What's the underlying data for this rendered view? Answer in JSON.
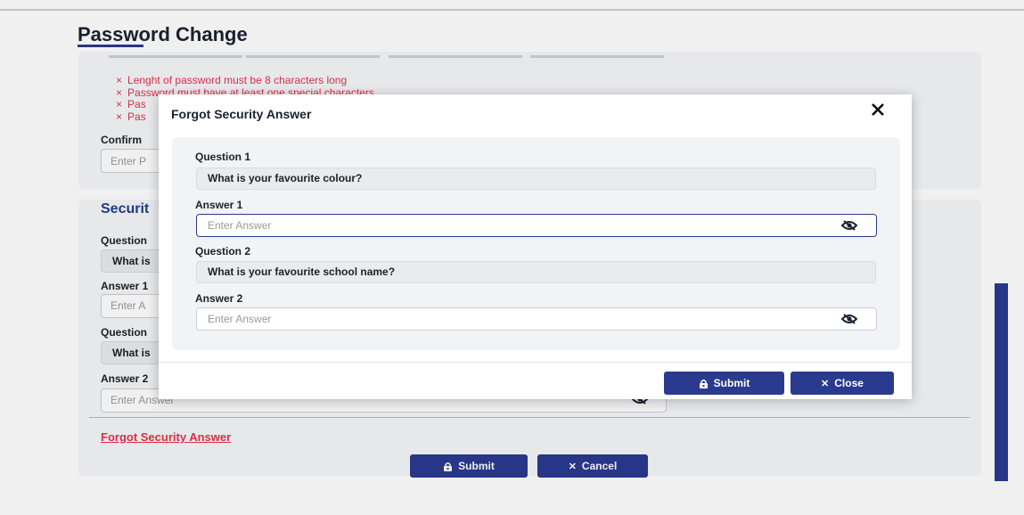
{
  "page": {
    "title": "Password Change",
    "rules": [
      "Lenght of password must be 8 characters long",
      "Password must have at least one special characters",
      "Pas",
      "Pas"
    ],
    "confirm_label": "Confirm",
    "confirm_placeholder": "Enter P",
    "security_title": "Securit",
    "question1_label": "Question",
    "question1_value": "What is",
    "answer1_label": "Answer 1",
    "answer1_placeholder": "Enter A",
    "question2_label": "Question",
    "question2_value": "What is",
    "answer2_label": "Answer 2",
    "answer2_placeholder": "Enter Answer",
    "forgot_link": "Forgot Security Answer",
    "submit_label": "Submit",
    "cancel_label": "Cancel"
  },
  "modal": {
    "title": "Forgot Security Answer",
    "close_icon": "×",
    "question1_label": "Question 1",
    "question1_value": "What is your favourite colour?",
    "answer1_label": "Answer 1",
    "answer1_placeholder": "Enter Answer",
    "question2_label": "Question 2",
    "question2_value": "What is your favourite school name?",
    "answer2_label": "Answer 2",
    "answer2_placeholder": "Enter Answer",
    "submit_label": "Submit",
    "close_label": "Close"
  },
  "icons": {
    "rule_fail": "×",
    "submit": "lock-icon",
    "close": "close-icon",
    "eye": "eye-slash-icon"
  },
  "colors": {
    "primary": "#2a3a8f",
    "error": "#e8304f",
    "link": "#1f3f8f"
  }
}
